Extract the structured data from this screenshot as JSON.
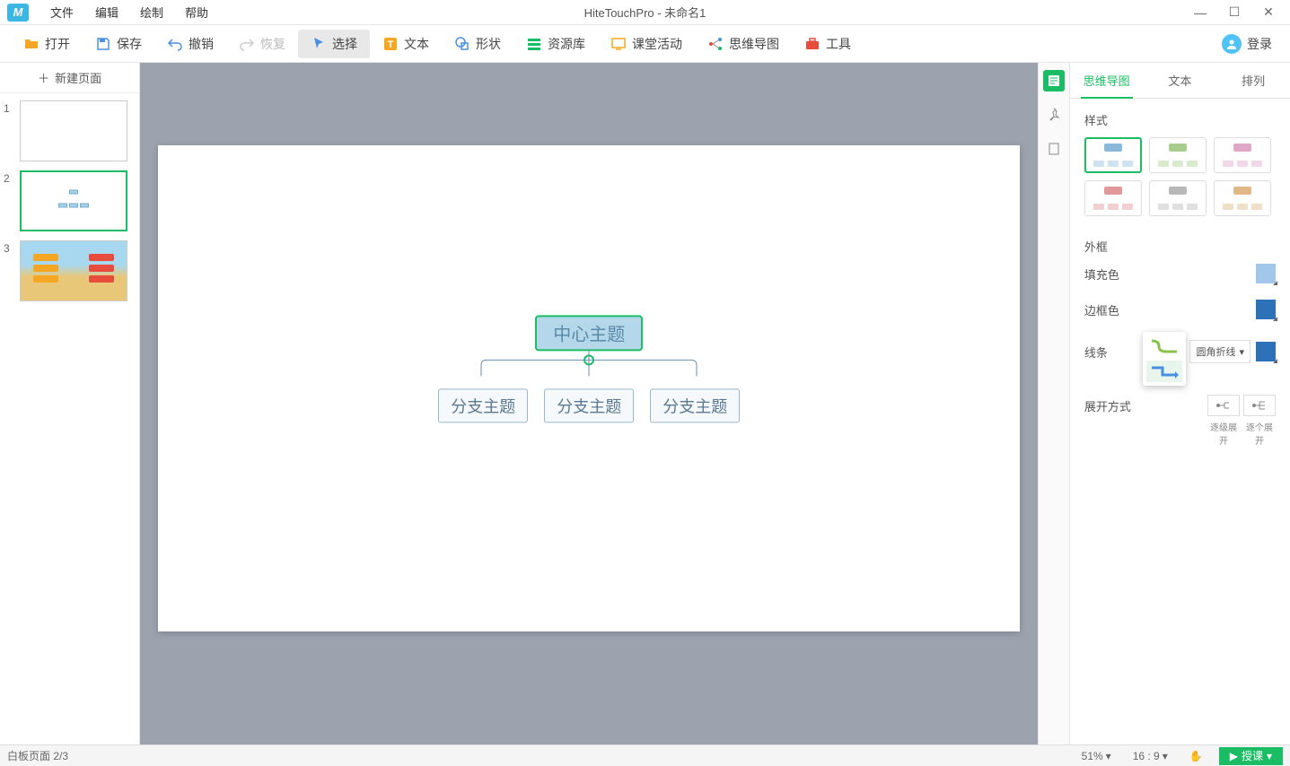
{
  "window": {
    "title": "HiteTouchPro - 未命名1"
  },
  "menu": {
    "file": "文件",
    "edit": "编辑",
    "draw": "绘制",
    "help": "帮助"
  },
  "toolbar": {
    "open": "打开",
    "save": "保存",
    "undo": "撤销",
    "redo": "恢复",
    "select": "选择",
    "text": "文本",
    "shape": "形状",
    "resources": "资源库",
    "class": "课堂活动",
    "mindmap": "思维导图",
    "tools": "工具",
    "login": "登录"
  },
  "sidebar": {
    "new_page": "新建页面",
    "thumbs": [
      {
        "n": "1"
      },
      {
        "n": "2"
      },
      {
        "n": "3"
      }
    ]
  },
  "mindmap": {
    "center": "中心主题",
    "branches": [
      "分支主题",
      "分支主题",
      "分支主题"
    ]
  },
  "panel": {
    "tabs": {
      "mindmap": "思维导图",
      "text": "文本",
      "arrange": "排列"
    },
    "style_label": "样式",
    "border_label": "外框",
    "fill_label": "填充色",
    "border_color_label": "边框色",
    "line_label": "线条",
    "line_type": "圆角折线",
    "expand_label": "展开方式",
    "expand_step": "逐级展开",
    "expand_all": "逐个展开"
  },
  "colors": {
    "fill": "#a3c7e8",
    "border": "#2d72b8",
    "line_swatch": "#2d72b8"
  },
  "status": {
    "page_info": "白板页面 2/3",
    "zoom": "51%",
    "ratio": "16 : 9",
    "teach": "授课"
  }
}
